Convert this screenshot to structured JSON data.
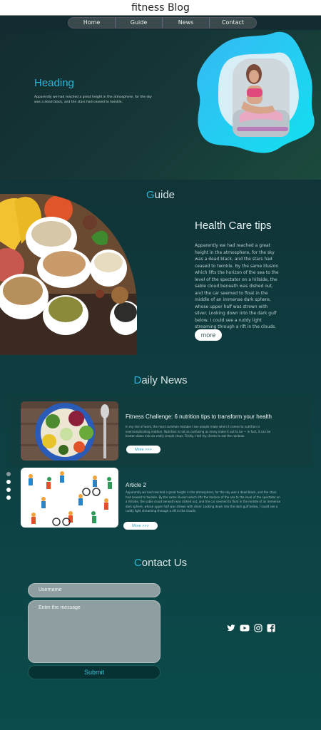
{
  "window": {
    "title": "fitness Blog"
  },
  "nav": {
    "items": [
      "Home",
      "Guide",
      "News",
      "Contact"
    ]
  },
  "hero": {
    "heading": "Heading",
    "text": "Apparently we had reached a great height in the atmosphere, for the sky was a dead black, and the stars had ceased to twinkle."
  },
  "guide": {
    "title_first": "G",
    "title_rest": "uide",
    "heading": "Health Care tips",
    "paragraph": "Apparently we had reached a great height in the atmosphere, for the sky was a dead black, and the stars had ceased to twinkle. By the same illusion which lifts the horizon of the sea to the level of the spectator on a hillside, the sable cloud beneath was dished out, and the car seemed to float in the middle of an immense dark sphere, whose upper half was strewn with silver. Looking down into the dark gulf below, I could see a ruddy light streaming through a rift in the clouds.",
    "more_label": "more"
  },
  "news": {
    "title_first": "D",
    "title_rest": "aily News",
    "articles": [
      {
        "title": "Fitness Challenge: 6 nutrition tips to transform your health",
        "text": "In my line of work, the most common mistake I see people make when it comes to nutrition is overcomplicating matters. Nutrition is not as confusing as many make it out to be — in fact, it can be broken down into six really simple steps. Firstly, I tell my clients to eat the rainbow.",
        "button": "More >>>"
      },
      {
        "title": "Article 2",
        "text": "Apparently we had reached a great height in the atmosphere, for the sky was a dead black, and the stars had ceased to twinkle. By the same illusion which lifts the horizon of the sea to the level of the spectator on a hillside, the sable cloud beneath was dished out, and the car seemed to float in the middle of an immense dark sphere, whose upper half was strewn with silver. Looking down into the dark gulf below, I could see a ruddy light streaming through a rift in the clouds.",
        "button": "More >>>"
      }
    ]
  },
  "contact": {
    "title_first": "C",
    "title_rest": "ontact Us",
    "username_placeholder": "Username",
    "message_placeholder": "Enter the message",
    "submit_label": "Submit",
    "socials": [
      "twitter-icon",
      "youtube-icon",
      "instagram-icon",
      "facebook-icon"
    ]
  },
  "colors": {
    "accent": "#2bb4d6",
    "background": "#0e3c3f"
  }
}
